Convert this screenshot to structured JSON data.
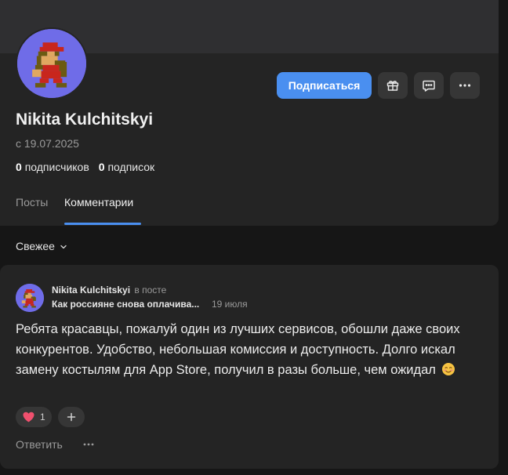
{
  "profile": {
    "name": "Nikita Kulchitskyi",
    "since": "с 19.07.2025",
    "followers_count": "0",
    "followers_label": "подписчиков",
    "following_count": "0",
    "following_label": "подписок",
    "avatar_icon": "pixel-plumber-avatar"
  },
  "actions": {
    "subscribe_label": "Подписаться",
    "gift_icon": "gift-icon",
    "message_icon": "message-icon",
    "more_icon": "more-dots-icon",
    "accent_color": "#4a8ff0"
  },
  "tabs": [
    {
      "label": "Посты",
      "active": false
    },
    {
      "label": "Комментарии",
      "active": true
    }
  ],
  "sort": {
    "label": "Свежее",
    "icon": "chevron-down-icon"
  },
  "comment": {
    "author": "Nikita Kulchitskyi",
    "context": "в посте",
    "post_title": "Как россияне снова оплачива...",
    "date": "19 июля",
    "text": "Ребята красавцы, пожалуй один из лучших сервисов, обошли даже своих конкурентов. Удобство, небольшая комиссия и доступность. Долго искал замену костылям для App Store, получил в разы больше, чем ожидал",
    "emoji": "smiling-face-emoji",
    "reactions": [
      {
        "icon": "heart-icon",
        "count": "1"
      }
    ],
    "add_reaction_icon": "plus-icon",
    "reply_label": "Ответить",
    "more_icon": "more-dots-icon"
  }
}
